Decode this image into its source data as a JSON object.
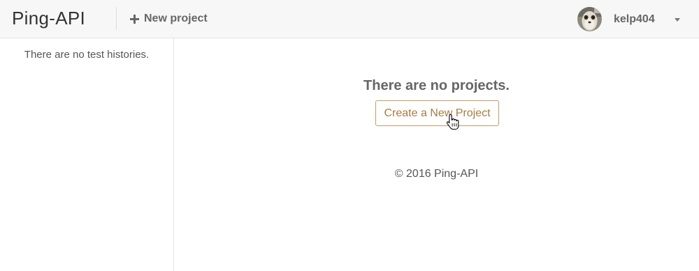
{
  "header": {
    "brand": "Ping-API",
    "new_project_label": "New project",
    "user": {
      "username": "kelp404",
      "avatar_icon": "user-avatar"
    }
  },
  "sidebar": {
    "empty_message": "There are no test histories."
  },
  "main": {
    "empty_title": "There are no projects.",
    "create_button_label": "Create a New Project",
    "footer": "© 2016 Ping-API"
  },
  "colors": {
    "accent": "#a97b41",
    "button_border": "#c69a62",
    "header_bg": "#f7f7f7"
  }
}
